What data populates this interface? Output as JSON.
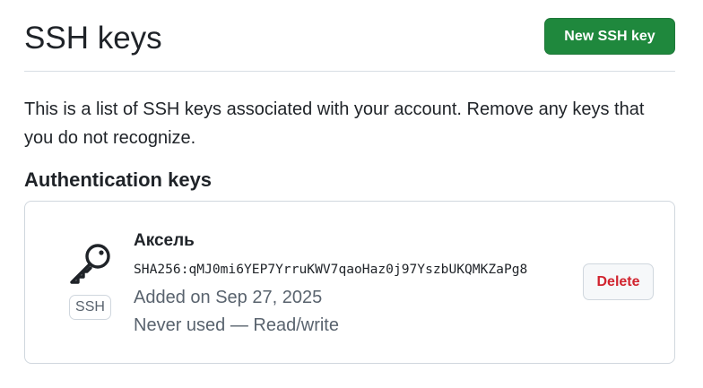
{
  "header": {
    "title": "SSH keys",
    "new_key_button": "New SSH key"
  },
  "description": "This is a list of SSH keys associated with your account. Remove any keys that you do not recognize.",
  "section": {
    "heading": "Authentication keys"
  },
  "keys": [
    {
      "title": "Аксель",
      "fingerprint": "SHA256:qMJ0mi6YEP7YrruKWV7qaoHaz0j97YszbUKQMKZaPg8",
      "added": "Added on Sep 27, 2025",
      "usage": "Never used — Read/write",
      "badge": "SSH",
      "icon": "key-icon",
      "delete_label": "Delete"
    }
  ],
  "colors": {
    "primary_button": "#1f883d",
    "danger_text": "#d1242f",
    "muted_text": "#59636e",
    "border": "#d0d7de"
  }
}
